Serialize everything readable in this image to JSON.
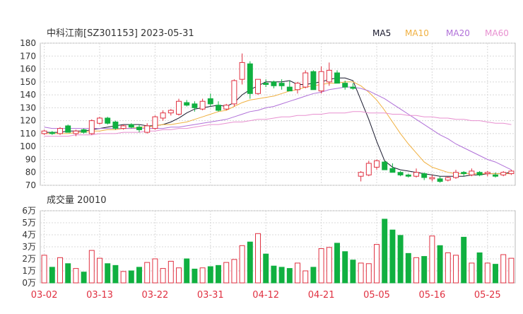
{
  "header": {
    "title": "中科江南[SZ301153] 2023-05-31",
    "legend": [
      {
        "label": "MA5",
        "color": "#1a1a2e"
      },
      {
        "label": "MA10",
        "color": "#f0b040"
      },
      {
        "label": "MA20",
        "color": "#b070d8"
      },
      {
        "label": "MA60",
        "color": "#e890d0"
      }
    ]
  },
  "colors": {
    "up": "#e03040",
    "down": "#10b040",
    "grid": "#d8d8d8",
    "axis": "#333333"
  },
  "chart_data": [
    {
      "type": "candlestick",
      "title": "中科江南[SZ301153] 2023-05-31",
      "ylim": [
        70,
        180
      ],
      "yticks": [
        70,
        80,
        90,
        100,
        110,
        120,
        130,
        140,
        150,
        160,
        170,
        180
      ],
      "x_tick_labels": [
        {
          "i": 0,
          "label": "03-02"
        },
        {
          "i": 7,
          "label": "03-13"
        },
        {
          "i": 14,
          "label": "03-22"
        },
        {
          "i": 21,
          "label": "03-31"
        },
        {
          "i": 28,
          "label": "04-12"
        },
        {
          "i": 35,
          "label": "04-21"
        },
        {
          "i": 42,
          "label": "05-05"
        },
        {
          "i": 49,
          "label": "05-16"
        },
        {
          "i": 56,
          "label": "05-25"
        }
      ],
      "ohlc": [
        [
          110,
          113,
          109,
          112
        ],
        [
          111,
          112,
          109,
          110
        ],
        [
          110,
          115,
          109,
          114
        ],
        [
          116,
          117,
          111,
          111
        ],
        [
          110,
          113,
          108,
          112
        ],
        [
          113,
          114,
          110,
          111
        ],
        [
          110,
          121,
          109,
          120
        ],
        [
          118,
          123,
          117,
          122
        ],
        [
          122,
          123,
          117,
          118
        ],
        [
          119,
          120,
          113,
          114
        ],
        [
          114,
          117,
          113,
          116
        ],
        [
          117,
          118,
          114,
          115
        ],
        [
          115,
          117,
          111,
          113
        ],
        [
          111,
          118,
          110,
          116
        ],
        [
          114,
          124,
          113,
          123
        ],
        [
          122,
          128,
          120,
          126
        ],
        [
          126,
          129,
          124,
          128
        ],
        [
          125,
          137,
          124,
          135
        ],
        [
          134,
          136,
          131,
          132
        ],
        [
          133,
          135,
          127,
          130
        ],
        [
          129,
          137,
          128,
          135
        ],
        [
          137,
          141,
          131,
          133
        ],
        [
          132,
          135,
          127,
          128
        ],
        [
          129,
          133,
          128,
          132
        ],
        [
          133,
          152,
          131,
          151
        ],
        [
          152,
          172,
          148,
          165
        ],
        [
          164,
          166,
          137,
          141
        ],
        [
          141,
          152,
          140,
          152
        ],
        [
          149,
          152,
          146,
          148
        ],
        [
          150,
          151,
          145,
          147
        ],
        [
          149,
          152,
          144,
          147
        ],
        [
          146,
          151,
          143,
          143
        ],
        [
          144,
          150,
          141,
          149
        ],
        [
          146,
          159,
          145,
          157
        ],
        [
          158,
          159,
          144,
          144
        ],
        [
          143,
          162,
          141,
          158
        ],
        [
          150,
          165,
          147,
          159
        ],
        [
          157,
          159,
          150,
          149
        ],
        [
          149,
          151,
          144,
          146
        ],
        [
          146,
          149,
          144,
          145
        ],
        [
          77,
          81,
          73,
          80
        ],
        [
          78,
          89,
          77,
          87
        ],
        [
          84,
          90,
          82,
          89
        ],
        [
          88,
          89,
          82,
          82
        ],
        [
          83,
          87,
          81,
          80
        ],
        [
          80,
          81,
          77,
          78
        ],
        [
          78,
          79,
          76,
          77
        ],
        [
          77,
          83,
          76,
          80
        ],
        [
          79,
          80,
          74,
          76
        ],
        [
          75,
          78,
          73,
          76
        ],
        [
          75,
          77,
          72,
          73
        ],
        [
          74,
          77,
          73,
          76
        ],
        [
          76,
          82,
          75,
          80
        ],
        [
          80,
          81,
          77,
          79
        ],
        [
          78,
          83,
          77,
          81
        ],
        [
          80,
          81,
          77,
          78
        ],
        [
          79,
          81,
          77,
          80
        ],
        [
          78,
          80,
          76,
          77
        ],
        [
          78,
          81,
          77,
          80
        ],
        [
          79,
          82,
          78,
          81
        ]
      ],
      "ma": {
        "MA5": [
          111,
          111,
          111,
          112,
          112,
          112,
          113,
          114,
          115,
          116,
          117,
          117,
          117,
          116,
          116,
          117,
          119,
          122,
          126,
          129,
          130,
          131,
          132,
          131,
          134,
          140,
          144,
          147,
          150,
          150,
          150,
          151,
          148,
          148,
          149,
          150,
          152,
          153,
          153,
          151,
          136,
          121,
          104,
          89,
          84,
          82,
          81,
          80,
          79,
          78,
          77,
          77,
          77,
          77,
          78,
          78,
          79,
          79,
          79,
          80
        ],
        "MA10": [
          110,
          110,
          110,
          110,
          111,
          111,
          112,
          112,
          113,
          113,
          114,
          114,
          115,
          115,
          116,
          117,
          117,
          118,
          119,
          121,
          123,
          125,
          127,
          128,
          131,
          134,
          136,
          137,
          138,
          139,
          141,
          143,
          144,
          146,
          147,
          148,
          149,
          149,
          150,
          150,
          147,
          142,
          136,
          128,
          119,
          110,
          102,
          95,
          88,
          84,
          82,
          80,
          79,
          79,
          79,
          79,
          79,
          79,
          79,
          79
        ],
        "MA20": [
          115,
          114,
          114,
          114,
          114,
          114,
          114,
          114,
          114,
          114,
          114,
          114,
          114,
          114,
          114,
          114,
          115,
          115,
          116,
          117,
          118,
          119,
          120,
          121,
          123,
          125,
          127,
          128,
          130,
          131,
          133,
          135,
          137,
          139,
          141,
          142,
          144,
          145,
          146,
          146,
          145,
          143,
          140,
          137,
          133,
          129,
          125,
          121,
          117,
          113,
          109,
          106,
          102,
          99,
          96,
          93,
          90,
          88,
          85,
          82
        ],
        "MA60": [
          108,
          108,
          108,
          108,
          109,
          109,
          109,
          110,
          110,
          110,
          111,
          111,
          111,
          112,
          112,
          113,
          113,
          114,
          114,
          115,
          116,
          117,
          117,
          118,
          119,
          119,
          120,
          121,
          121,
          122,
          123,
          123,
          124,
          124,
          125,
          125,
          126,
          126,
          126,
          127,
          127,
          126,
          126,
          126,
          125,
          125,
          124,
          124,
          123,
          123,
          122,
          122,
          121,
          121,
          120,
          120,
          119,
          118,
          118,
          117
        ]
      }
    },
    {
      "type": "bar",
      "title": "成交量 20010",
      "ylim": [
        0,
        60000
      ],
      "yticks": [
        {
          "value": 0,
          "label": "0万"
        },
        {
          "value": 10000,
          "label": "1万"
        },
        {
          "value": 20000,
          "label": "2万"
        },
        {
          "value": 30000,
          "label": "3万"
        },
        {
          "value": 40000,
          "label": "4万"
        },
        {
          "value": 50000,
          "label": "5万"
        },
        {
          "value": 60000,
          "label": "6万"
        }
      ],
      "volume": [
        23000,
        13000,
        21000,
        16000,
        12000,
        9000,
        27000,
        20500,
        16000,
        14500,
        9500,
        10000,
        13000,
        17000,
        20000,
        12000,
        18000,
        12500,
        20000,
        11500,
        12500,
        13500,
        14500,
        17000,
        19500,
        31000,
        34000,
        41000,
        24000,
        14000,
        13000,
        12000,
        16500,
        10000,
        13000,
        28500,
        29500,
        33000,
        26000,
        19000,
        16500,
        16000,
        32000,
        53000,
        44000,
        39500,
        24500,
        21000,
        22000,
        39000,
        31000,
        25000,
        23000,
        38000,
        16500,
        25000,
        16500,
        15500,
        23500,
        20500
      ]
    }
  ]
}
